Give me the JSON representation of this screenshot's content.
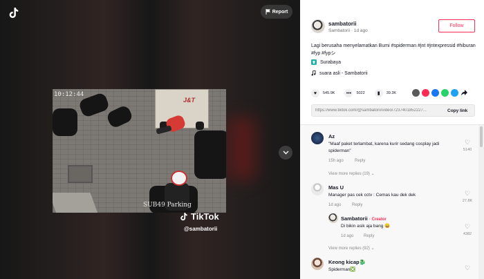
{
  "video": {
    "report_label": "Report",
    "cctv_timestamp": "10:12:44",
    "cctv_location": "SUB49 Parking",
    "truck_label": "J&T",
    "watermark_brand": "TikTok",
    "watermark_handle": "@sambatorii"
  },
  "author": {
    "username": "sambatorii",
    "subline": "Sambatorii · 1d ago",
    "follow_label": "Follow"
  },
  "post": {
    "description": "Lagi berusaha menyelamatkan Bumi #spiderman #jnt #jntexpressid #hiburan #fyp #fypシ",
    "location": "Surabaya",
    "music": "suara asli - Sambatorii"
  },
  "stats": {
    "likes": "545.9K",
    "comments": "5022",
    "saves": "39.3K"
  },
  "share": {
    "colors": [
      "#5a5a5a",
      "#fe2c55",
      "#1877f2",
      "#25d366",
      "#1da1f2"
    ]
  },
  "link": {
    "url": "https://www.tiktok.com/@sambatorii/video/7237401852227...",
    "copy_label": "Copy link"
  },
  "comments": [
    {
      "name": "Az",
      "text": "\"Maaf paket terlambat, karena kurir sedang cosplay jadi spiderman\"",
      "time": "15h ago",
      "reply": "Reply",
      "likes": "5140",
      "view_replies": "View more replies (19)"
    },
    {
      "name": "Mas U",
      "text": "Manager pas cek cctv : Cemas kau dek dek",
      "time": "1d ago",
      "reply": "Reply",
      "likes": "27.8K"
    },
    {
      "name": "Sambatorii",
      "badge": "· Creator",
      "text": "Di bikin asik aja bang 😄",
      "time": "1d ago",
      "reply": "Reply",
      "likes": "4382",
      "view_replies": "View more replies (92)"
    },
    {
      "name": "Keong kicap🐉",
      "text": "Spiderman❎",
      "likes": "0"
    }
  ]
}
